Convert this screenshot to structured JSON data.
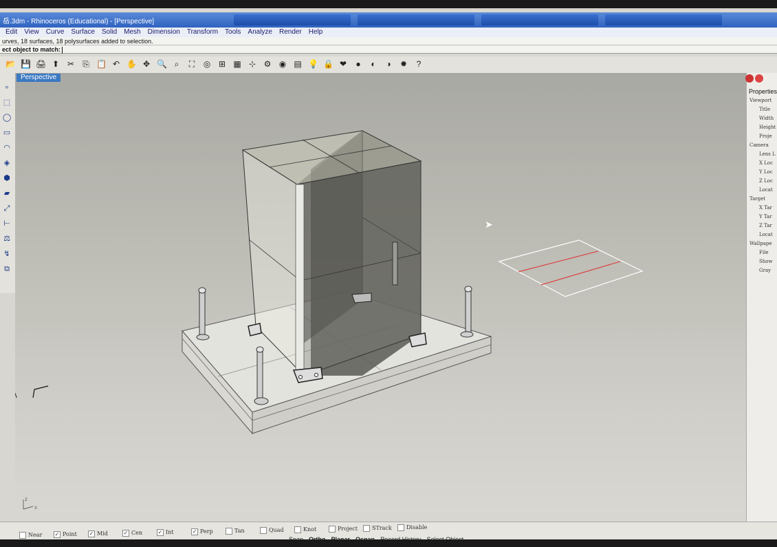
{
  "window": {
    "title": "岳.3dm - Rhinoceros (Educational) - [Perspective]"
  },
  "menu": [
    "Edit",
    "View",
    "Curve",
    "Surface",
    "Solid",
    "Mesh",
    "Dimension",
    "Transform",
    "Tools",
    "Analyze",
    "Render",
    "Help"
  ],
  "command_history": "urves, 18 surfaces, 18 polysurfaces added to selection.",
  "command_prompt": "ect object to match:",
  "viewport": {
    "label": "Perspective",
    "background_top": "#a9a9a3",
    "background_bottom": "#d8d7d2"
  },
  "toolbar_icons": [
    "new-file-icon",
    "save-icon",
    "print-icon",
    "import-icon",
    "cut-icon",
    "copy-icon",
    "paste-icon",
    "undo-icon",
    "pan-icon",
    "rotate-icon",
    "zoom-icon",
    "zoom-window-icon",
    "zoom-extents-icon",
    "zoom-selected-icon",
    "4-views-icon",
    "grid-icon",
    "cplane-icon",
    "object-properties-icon",
    "osnap-icon",
    "layer-icon",
    "light-icon",
    "lock-icon",
    "render-icon",
    "shade-icon",
    "material-icon",
    "environment-icon",
    "settings-icon",
    "help-icon"
  ],
  "left_toolbar_icons": [
    "point-icon",
    "curve-icon",
    "circle-icon",
    "rectangle-icon",
    "arc-icon",
    "surface-icon",
    "solid-icon",
    "mesh-icon",
    "transform-icon",
    "dimension-icon",
    "analyze-icon",
    "fillet-icon",
    "group-icon"
  ],
  "properties": {
    "header": "Properties",
    "rows": [
      "Viewport",
      "Title",
      "Width",
      "Height",
      "Proje",
      "Camera",
      "Lens L",
      "X Loc",
      "Y Loc",
      "Z Loc",
      "Locat",
      "Target",
      "X Tar",
      "Y Tar",
      "Z Tar",
      "Locat",
      "Wallpape",
      "File",
      "Show",
      "Gray"
    ]
  },
  "osnaps": [
    {
      "label": "Near",
      "checked": false
    },
    {
      "label": "Point",
      "checked": true
    },
    {
      "label": "Mid",
      "checked": true
    },
    {
      "label": "Cen",
      "checked": true
    },
    {
      "label": "Int",
      "checked": true
    },
    {
      "label": "Perp",
      "checked": true
    },
    {
      "label": "Tan",
      "checked": false
    },
    {
      "label": "Quad",
      "checked": false
    },
    {
      "label": "Knot",
      "checked": false
    },
    {
      "label": "Project",
      "checked": false
    },
    {
      "label": "STrack",
      "checked": false
    },
    {
      "label": "Disable",
      "checked": false
    }
  ],
  "status_panes": [
    "Snap",
    "Ortho",
    "Planar",
    "Osnap",
    "Record History",
    "Select Object"
  ],
  "colors": {
    "accent": "#3b79c2",
    "selection_line": "#e03030"
  }
}
